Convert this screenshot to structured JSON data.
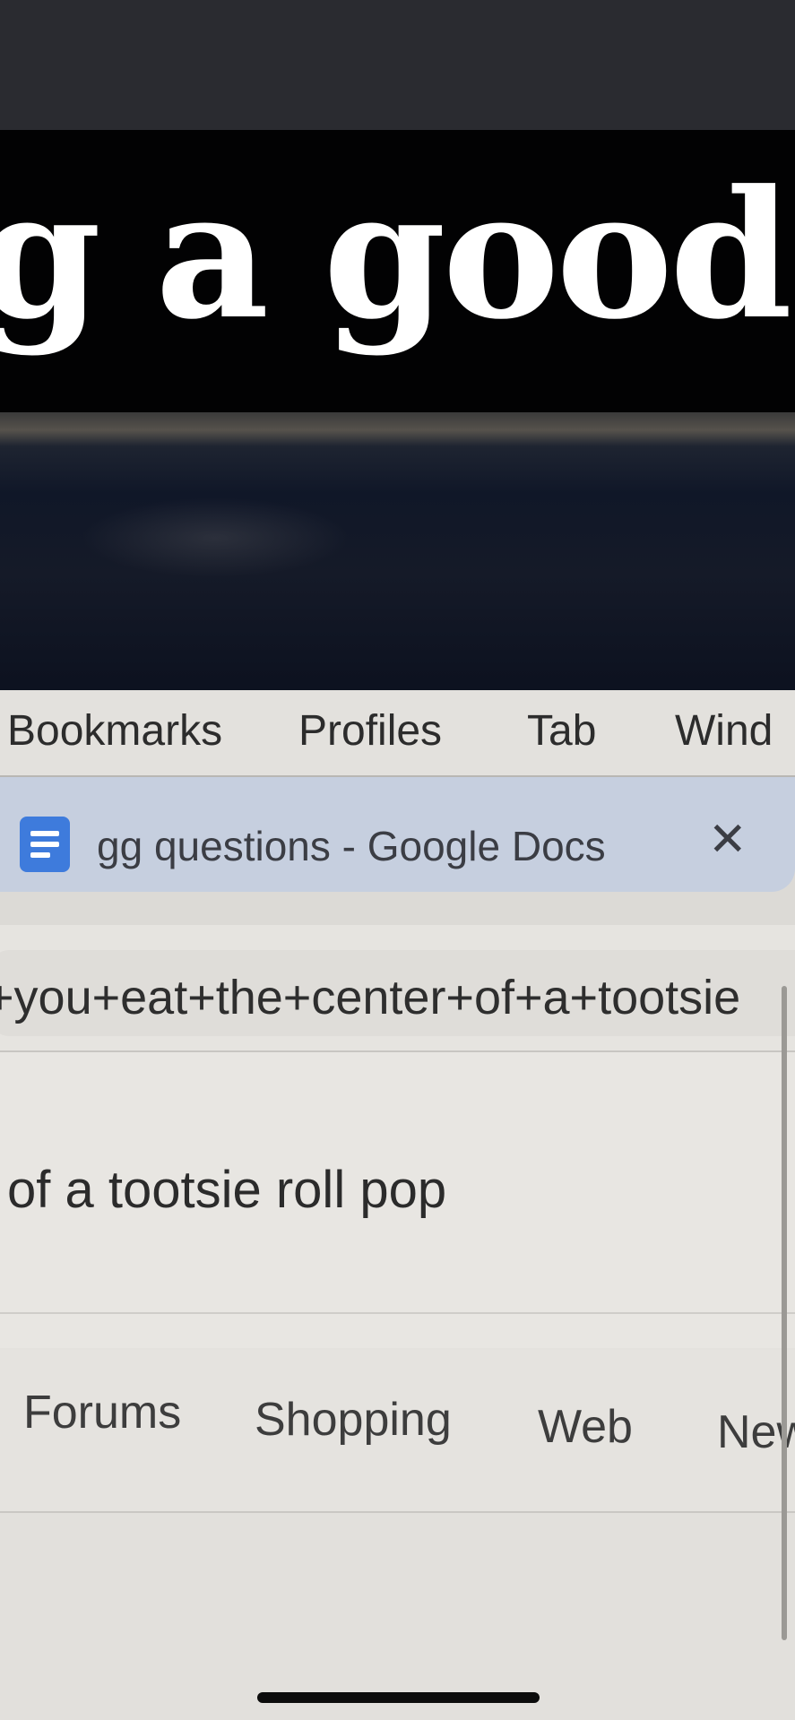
{
  "caption": {
    "text": "g a good d"
  },
  "browser": {
    "menu_bar": {
      "items": [
        "Bookmarks",
        "Profiles",
        "Tab",
        "Wind"
      ]
    },
    "tab": {
      "title": "gg questions - Google Docs",
      "icon": "google-docs-icon",
      "close_icon": "close-icon",
      "close_symbol": "✕"
    },
    "address_bar": {
      "url": "+you+eat+the+center+of+a+tootsie"
    }
  },
  "search": {
    "query": "of a tootsie roll pop",
    "tabs": [
      "Forums",
      "Shopping",
      "Web",
      "New"
    ]
  },
  "colors": {
    "caption_bg": "#020203",
    "active_tab_bg": "#c6cfdf",
    "docs_icon": "#3e7bdc"
  }
}
